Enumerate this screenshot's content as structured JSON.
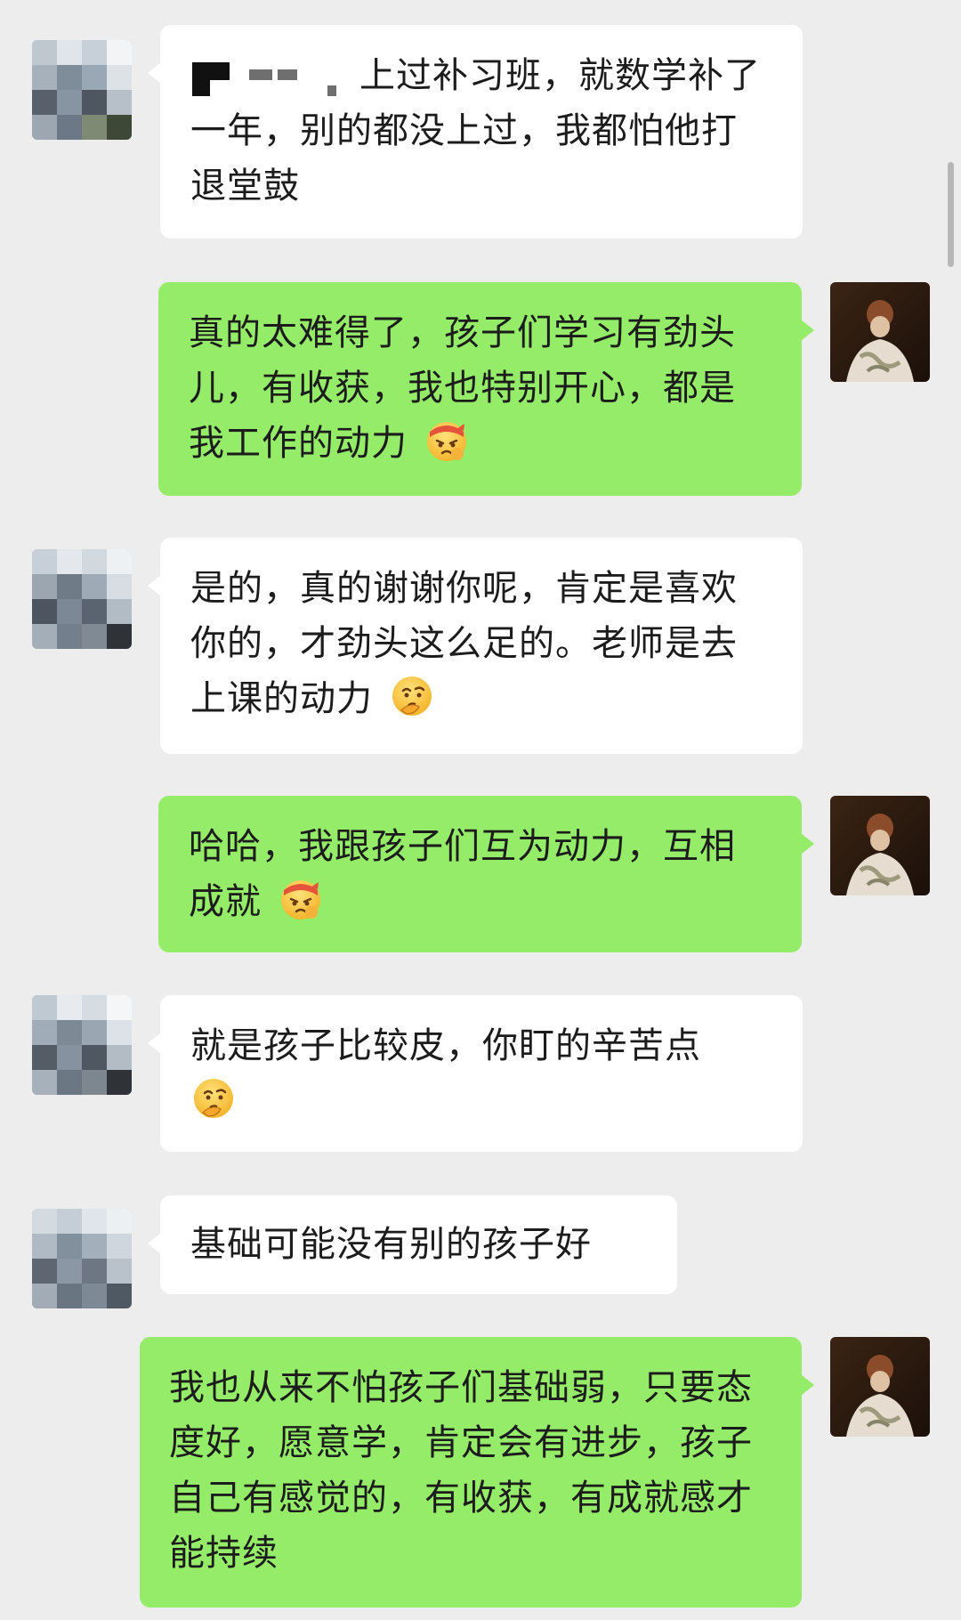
{
  "messages": [
    {
      "side": "left",
      "text": "上过补习班，就数学补了一年，别的都没上过，我都怕他打退堂鼓",
      "redacted_prefix": true
    },
    {
      "side": "right",
      "text": "真的太难得了，孩子们学习有劲头儿，有收获，我也特别开心，都是我工作的动力",
      "emoji": "determined-face-headband-emoji"
    },
    {
      "side": "left",
      "text": "是的，真的谢谢你呢，肯定是喜欢你的，才劲头这么足的。老师是去上课的动力",
      "emoji": "thinking-face-emoji"
    },
    {
      "side": "right",
      "text": "哈哈，我跟孩子们互为动力，互相成就",
      "emoji": "determined-face-headband-emoji"
    },
    {
      "side": "left",
      "text": "就是孩子比较皮，你盯的辛苦点",
      "emoji": "thinking-face-emoji"
    },
    {
      "side": "left",
      "text": "基础可能没有别的孩子好"
    },
    {
      "side": "right",
      "text": "我也从来不怕孩子们基础弱，只要态度好，愿意学，肯定会有进步，孩子自己有感觉的，有收获，有成就感才能持续"
    }
  ],
  "colors": {
    "background": "#ededed",
    "incoming_bubble": "#ffffff",
    "outgoing_bubble": "#95ec69",
    "text": "#1c1c1c"
  }
}
